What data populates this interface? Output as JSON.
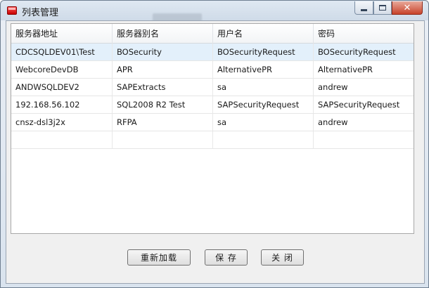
{
  "window": {
    "title": "列表管理",
    "close_glyph": "✕"
  },
  "table": {
    "columns": [
      "服务器地址",
      "服务器别名",
      "用户名",
      "密码"
    ],
    "rows": [
      [
        "CDCSQLDEV01\\Test",
        "BOSecurity",
        "BOSecurityRequest",
        "BOSecurityRequest"
      ],
      [
        "WebcoreDevDB",
        "APR",
        "AlternativePR",
        "AlternativePR"
      ],
      [
        "ANDWSQLDEV2",
        "SAPExtracts",
        "sa",
        "andrew"
      ],
      [
        "192.168.56.102",
        "SQL2008 R2 Test",
        "SAPSecurityRequest",
        "SAPSecurityRequest"
      ],
      [
        "cnsz-dsl3j2x",
        "RFPA",
        "sa",
        "andrew"
      ]
    ]
  },
  "buttons": {
    "reload": "重新加载",
    "save": "保 存",
    "close": "关 闭"
  },
  "colors": {
    "selected_row": "#e3f0fb",
    "close_button": "#c8432b"
  },
  "icons": {
    "app": "app-icon",
    "minimize": "minimize-icon",
    "maximize": "maximize-icon",
    "close": "close-icon"
  }
}
